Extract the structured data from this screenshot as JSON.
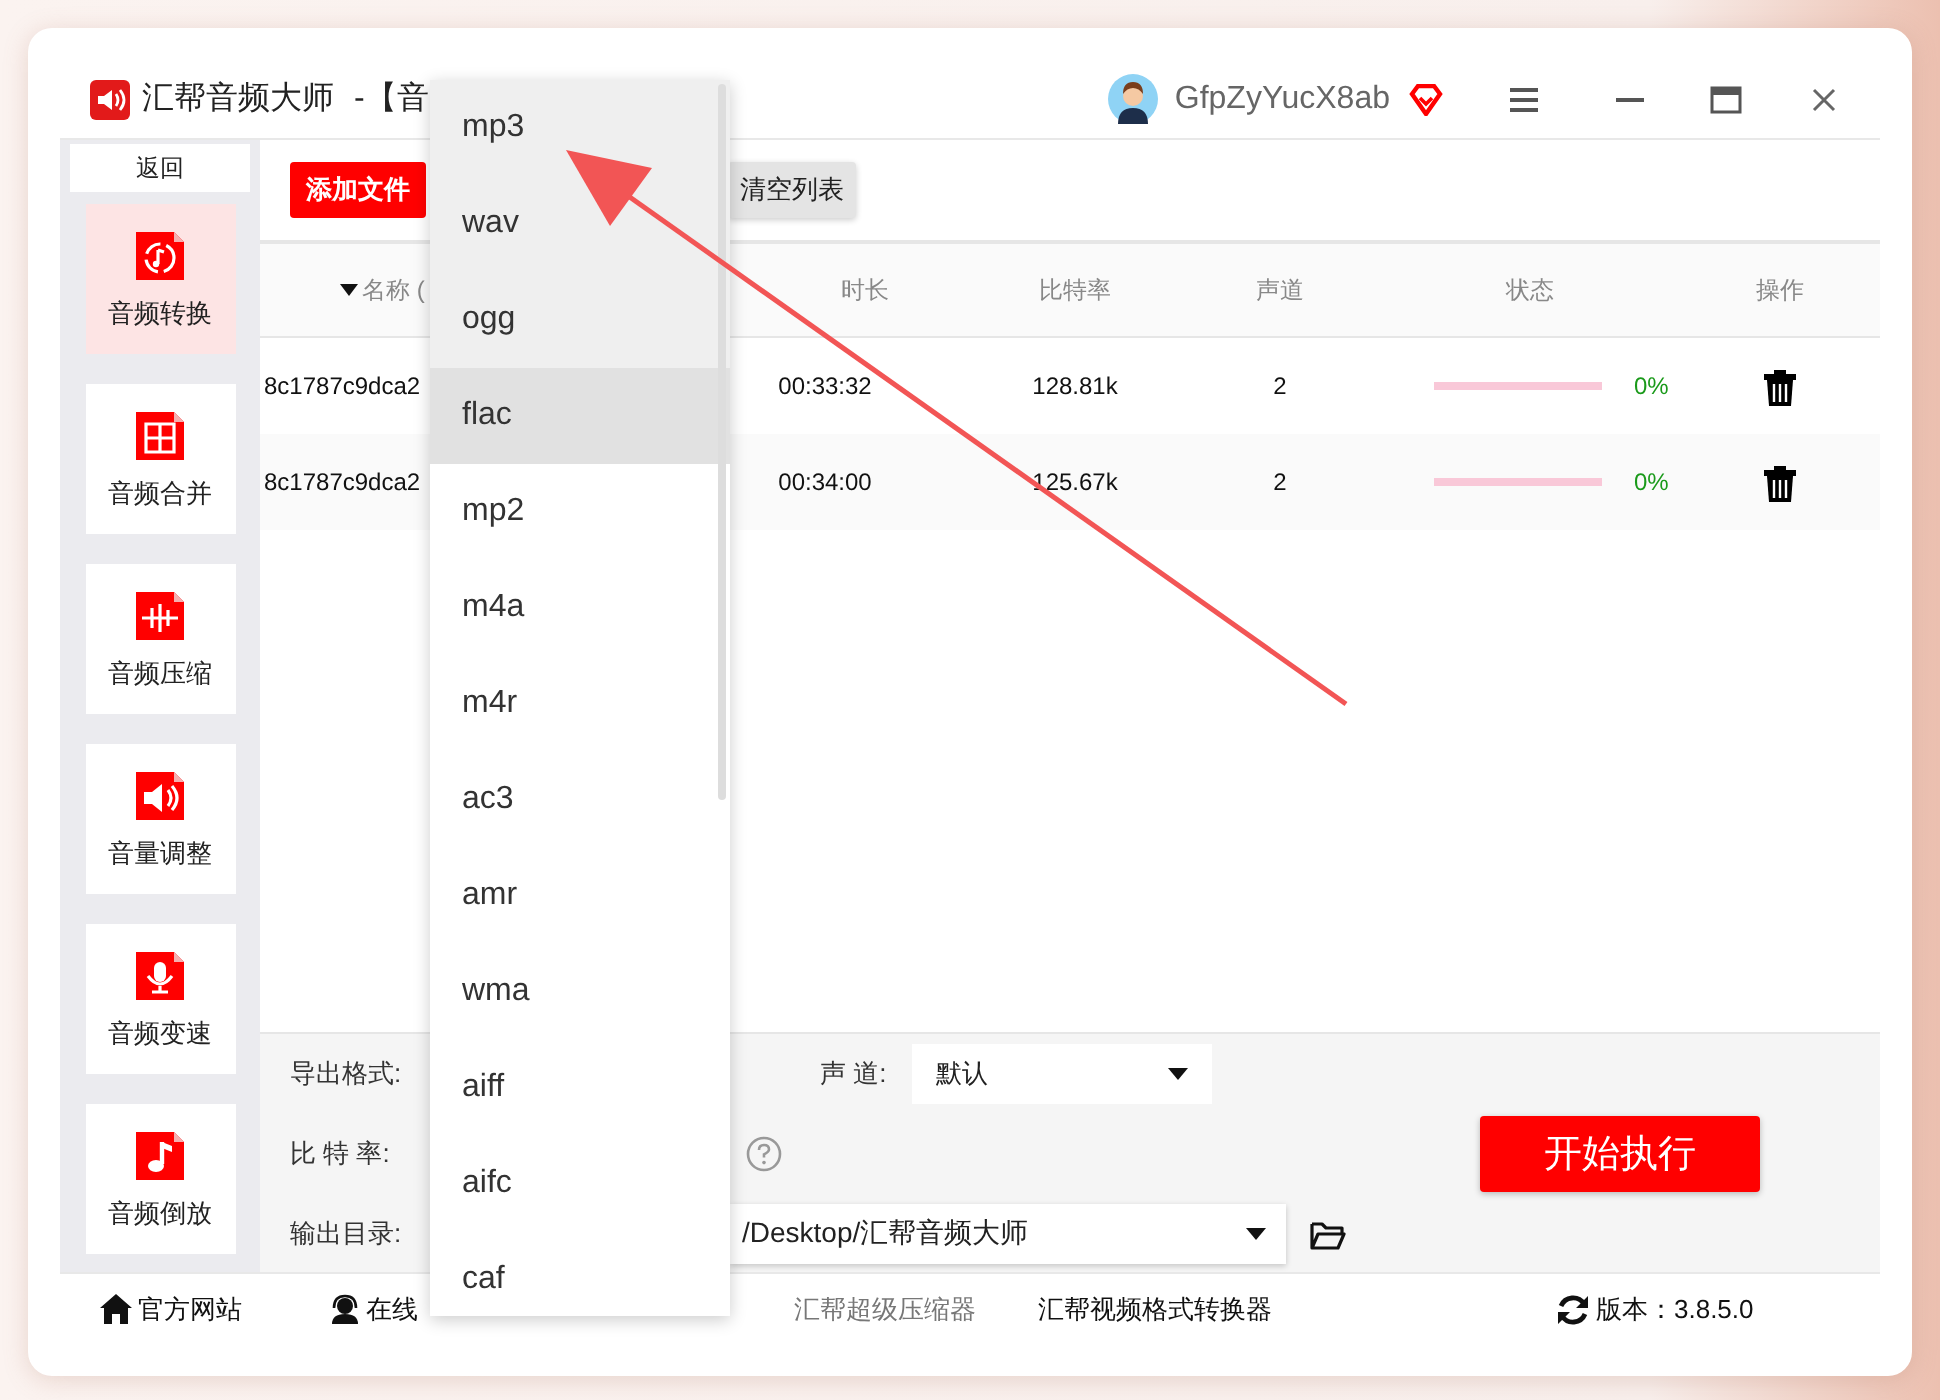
{
  "window": {
    "app_name": "汇帮音频大师",
    "title_suffix": "-【音",
    "username": "GfpZyYucX8ab"
  },
  "sidebar": {
    "back": "返回",
    "items": [
      {
        "label": "音频转换",
        "selected": true
      },
      {
        "label": "音频合并",
        "selected": false
      },
      {
        "label": "音频压缩",
        "selected": false
      },
      {
        "label": "音量调整",
        "selected": false
      },
      {
        "label": "音频变速",
        "selected": false
      },
      {
        "label": "音频倒放",
        "selected": false
      }
    ]
  },
  "toolbar": {
    "add_button": "添加文件",
    "clear_button": "清空列表"
  },
  "table": {
    "columns": [
      "名称 (",
      "时长",
      "比特率",
      "声道",
      "状态",
      "操作"
    ],
    "rows": [
      {
        "name": "8c1787c9dca2",
        "duration": "00:33:32",
        "bitrate": "128.81k",
        "channels": "2",
        "level": 0,
        "percent": "0%"
      },
      {
        "name": "8c1787c9dca2",
        "duration": "00:34:00",
        "bitrate": "125.67k",
        "channels": "2",
        "level": 0,
        "percent": "0%"
      }
    ]
  },
  "settings": {
    "format_label": "导出格式:",
    "channel_label": "声 道:",
    "channel_value": "默认",
    "bitrate_label": "比 特 率:",
    "output_label": "输出目录:",
    "output_path": "/Desktop/汇帮音频大师",
    "start_button": "开始执行"
  },
  "footer": {
    "website": "官方网站",
    "support": "在线",
    "compressor": "汇帮超级压缩器",
    "video_converter": "汇帮视频格式转换器",
    "version": "版本：3.8.5.0"
  },
  "format_menu": {
    "items": [
      {
        "label": "mp3",
        "shaded": true,
        "hovered": false
      },
      {
        "label": "wav",
        "shaded": true,
        "hovered": false
      },
      {
        "label": "ogg",
        "shaded": true,
        "hovered": false
      },
      {
        "label": "flac",
        "shaded": false,
        "hovered": true
      },
      {
        "label": "mp2",
        "shaded": false,
        "hovered": false
      },
      {
        "label": "m4a",
        "shaded": false,
        "hovered": false
      },
      {
        "label": "m4r",
        "shaded": false,
        "hovered": false
      },
      {
        "label": "ac3",
        "shaded": false,
        "hovered": false
      },
      {
        "label": "amr",
        "shaded": false,
        "hovered": false
      },
      {
        "label": "wma",
        "shaded": false,
        "hovered": false
      },
      {
        "label": "aiff",
        "shaded": false,
        "hovered": false
      },
      {
        "label": "aifc",
        "shaded": false,
        "hovered": false
      },
      {
        "label": "caf",
        "shaded": false,
        "hovered": false
      }
    ]
  }
}
